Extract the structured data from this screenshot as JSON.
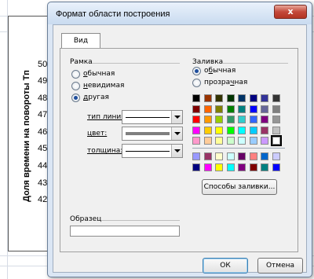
{
  "sheet": {
    "y_axis_label": "Доля времени на повороты Тп",
    "y_ticks": [
      "50",
      "49",
      "48",
      "47",
      "46",
      "45",
      "44",
      "43",
      "42"
    ]
  },
  "dialog": {
    "title": "Формат области построения",
    "close_label": "x",
    "tab_label": "Вид",
    "border": {
      "group_label": "Рамка",
      "options": [
        {
          "prefix": "",
          "underline": "о",
          "rest": "бычная",
          "checked": false
        },
        {
          "prefix": "",
          "underline": "н",
          "rest": "евидимая",
          "checked": false
        },
        {
          "prefix": "",
          "underline": "д",
          "rest": "ругая",
          "checked": true
        }
      ],
      "line_type_label": "тип линии:",
      "color_label": "цвет:",
      "thickness_label": "толщина:"
    },
    "fill": {
      "group_label": "Заливка",
      "options": [
        {
          "prefix": "о",
          "underline": "б",
          "rest": "ычная",
          "checked": true
        },
        {
          "prefix": "прозра",
          "underline": "ч",
          "rest": "ная",
          "checked": false
        }
      ],
      "palette_top": [
        [
          "#000000",
          "#993300",
          "#333300",
          "#003300",
          "#003366",
          "#000080",
          "#333399",
          "#333333"
        ],
        [
          "#800000",
          "#FF6600",
          "#808000",
          "#008000",
          "#008080",
          "#0000FF",
          "#666699",
          "#808080"
        ],
        [
          "#FF0000",
          "#FF9900",
          "#99CC00",
          "#339966",
          "#33CCCC",
          "#3366FF",
          "#800080",
          "#969696"
        ],
        [
          "#FF00FF",
          "#FFCC00",
          "#FFFF00",
          "#00FF00",
          "#00FFFF",
          "#00CCFF",
          "#993366",
          "#C0C0C0"
        ],
        [
          "#FF99CC",
          "#FFCC99",
          "#FFFF99",
          "#CCFFCC",
          "#CCFFFF",
          "#99CCFF",
          "#CC99FF",
          "#FFFFFF"
        ]
      ],
      "palette_bottom": [
        [
          "#9999FF",
          "#993366",
          "#FFFFCC",
          "#CCFFFF",
          "#660066",
          "#FF8080",
          "#0066CC",
          "#CCCCFF"
        ],
        [
          "#000080",
          "#FF00FF",
          "#FFFF00",
          "#00FFFF",
          "#800080",
          "#800000",
          "#008080",
          "#0000FF"
        ]
      ],
      "selected_swatch": "#FFFFFF",
      "fill_effects_label": "Способы заливки..."
    },
    "sample_label": "Образец",
    "ok_label": "ОК",
    "cancel_label": "Отмена"
  }
}
